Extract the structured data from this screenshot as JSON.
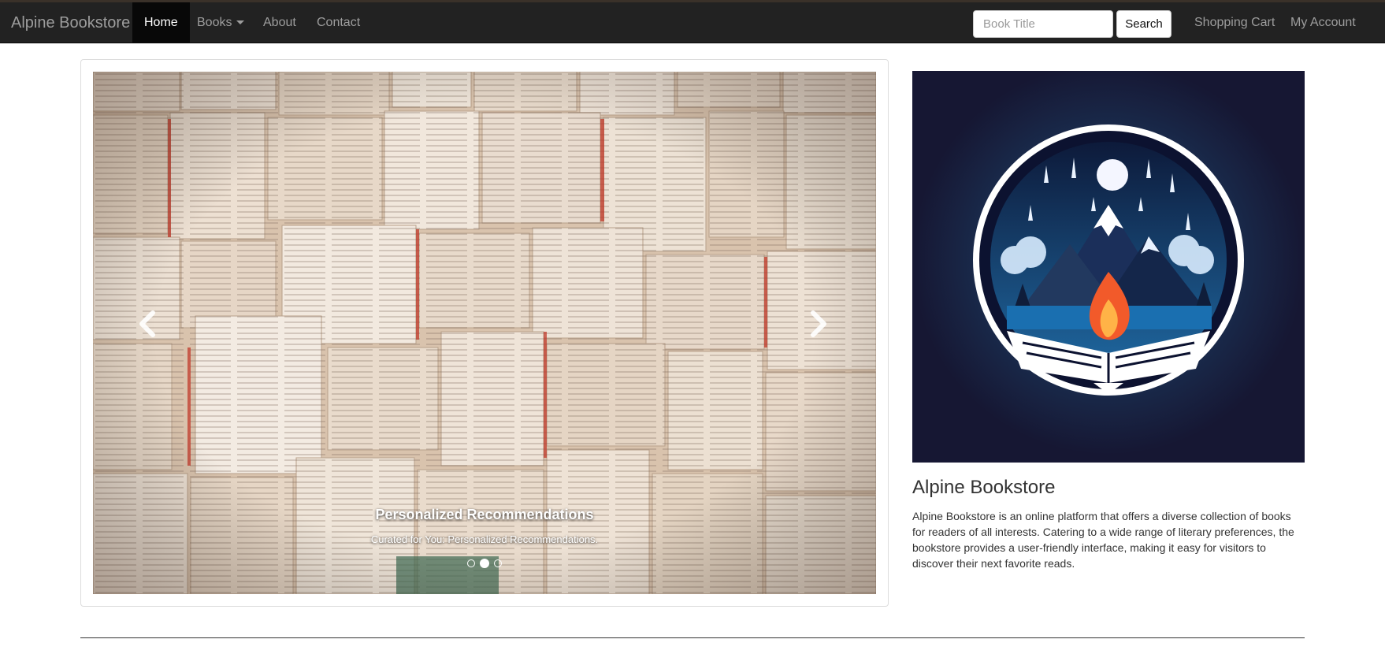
{
  "navbar": {
    "brand": "Alpine Bookstore",
    "items": [
      {
        "label": "Home",
        "active": true
      },
      {
        "label": "Books",
        "dropdown": true
      },
      {
        "label": "About"
      },
      {
        "label": "Contact"
      }
    ],
    "search": {
      "placeholder": "Book Title",
      "button_label": "Search"
    },
    "right_items": [
      {
        "label": "Shopping Cart"
      },
      {
        "label": "My Account"
      }
    ]
  },
  "carousel": {
    "caption_title": "Personalized Recommendations",
    "caption_text": "Curated for You: Personalized Recommendations.",
    "indicators": 3,
    "active_indicator": 1,
    "prev_icon": "chevron-left-icon",
    "next_icon": "chevron-right-icon"
  },
  "about": {
    "title": "Alpine Bookstore",
    "description": "Alpine Bookstore is an online platform that offers a diverse collection of books for readers of all interests. Catering to a wide range of literary preferences, the bookstore provides a user-friendly interface, making it easy for visitors to discover their next favorite reads."
  },
  "colors": {
    "navbar_bg": "#222222",
    "logo_bg": "#161733",
    "accent_blue": "#4ba3d6",
    "flame": "#f25a2a"
  }
}
